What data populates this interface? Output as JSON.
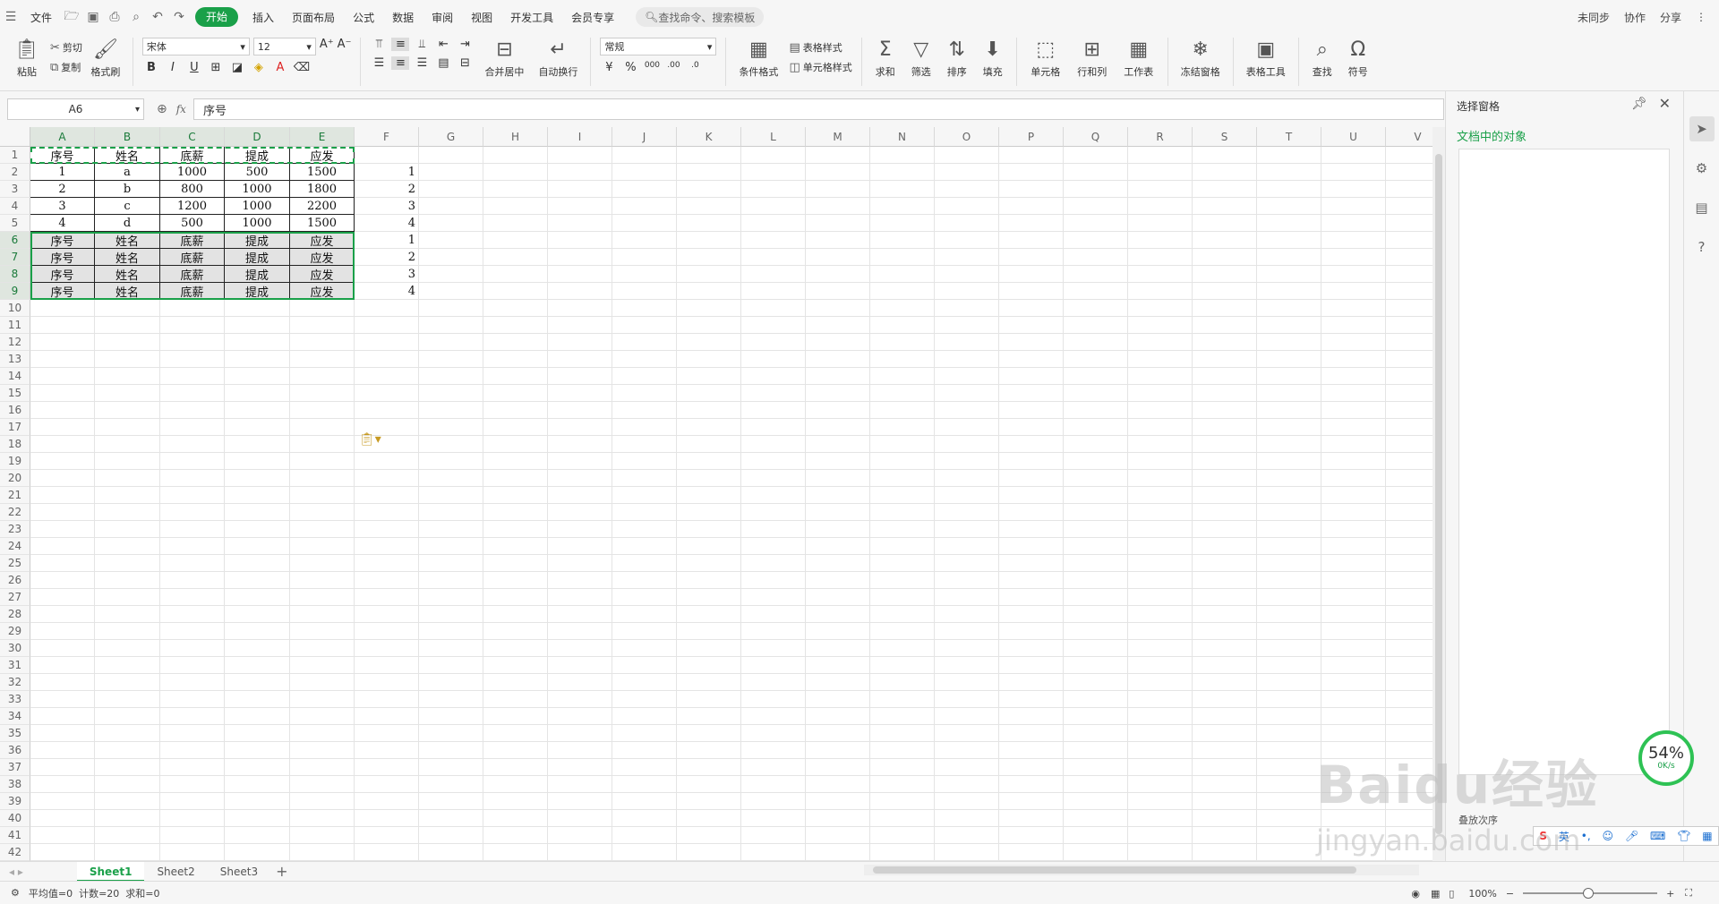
{
  "menu": {
    "file": "文件",
    "items": [
      "开始",
      "插入",
      "页面布局",
      "公式",
      "数据",
      "审阅",
      "视图",
      "开发工具",
      "会员专享"
    ],
    "search": "查找命令、搜索模板",
    "right": [
      "未同步",
      "协作",
      "分享"
    ]
  },
  "ribbon": {
    "paste": "粘贴",
    "cut": "剪切",
    "copy": "复制",
    "format_painter": "格式刷",
    "font_name": "宋体",
    "font_size": "12",
    "merge": "合并居中",
    "wrap": "自动换行",
    "number_format": "常规",
    "table_style": "表格样式",
    "cond_format": "条件格式",
    "cell_style": "单元格样式",
    "sum": "求和",
    "filter": "筛选",
    "sort": "排序",
    "fill": "填充",
    "cell": "单元格",
    "rowcol": "行和列",
    "sheet": "工作表",
    "freeze": "冻结窗格",
    "table_tools": "表格工具",
    "find": "查找",
    "symbol": "符号"
  },
  "formula_bar": {
    "name_box": "A6",
    "fx": "fx",
    "content": "序号"
  },
  "grid": {
    "columns": [
      "A",
      "B",
      "C",
      "D",
      "E",
      "F",
      "G",
      "H",
      "I",
      "J",
      "K",
      "L",
      "M",
      "N",
      "O",
      "P",
      "Q",
      "R",
      "S",
      "T",
      "U",
      "V"
    ],
    "row_count": 42,
    "cells": [
      [
        "序号",
        "姓名",
        "底薪",
        "提成",
        "应发",
        ""
      ],
      [
        "1",
        "a",
        "1000",
        "500",
        "1500",
        "1"
      ],
      [
        "2",
        "b",
        "800",
        "1000",
        "1800",
        "2"
      ],
      [
        "3",
        "c",
        "1200",
        "1000",
        "2200",
        "3"
      ],
      [
        "4",
        "d",
        "500",
        "1000",
        "1500",
        "4"
      ],
      [
        "序号",
        "姓名",
        "底薪",
        "提成",
        "应发",
        "1"
      ],
      [
        "序号",
        "姓名",
        "底薪",
        "提成",
        "应发",
        "2"
      ],
      [
        "序号",
        "姓名",
        "底薪",
        "提成",
        "应发",
        "3"
      ],
      [
        "序号",
        "姓名",
        "底薪",
        "提成",
        "应发",
        "4"
      ]
    ]
  },
  "panel": {
    "title": "选择窗格",
    "subtitle": "文档中的对象",
    "order": "叠放次序"
  },
  "sheets": [
    "Sheet1",
    "Sheet2",
    "Sheet3"
  ],
  "status": {
    "text": "平均值=0  计数=20  求和=0",
    "zoom": "100%"
  },
  "gauge": {
    "percent": "54%",
    "speed": "0K/s"
  },
  "watermark": {
    "brand": "Baidu经验",
    "url": "jingyan.baidu.com"
  },
  "ime": "英"
}
